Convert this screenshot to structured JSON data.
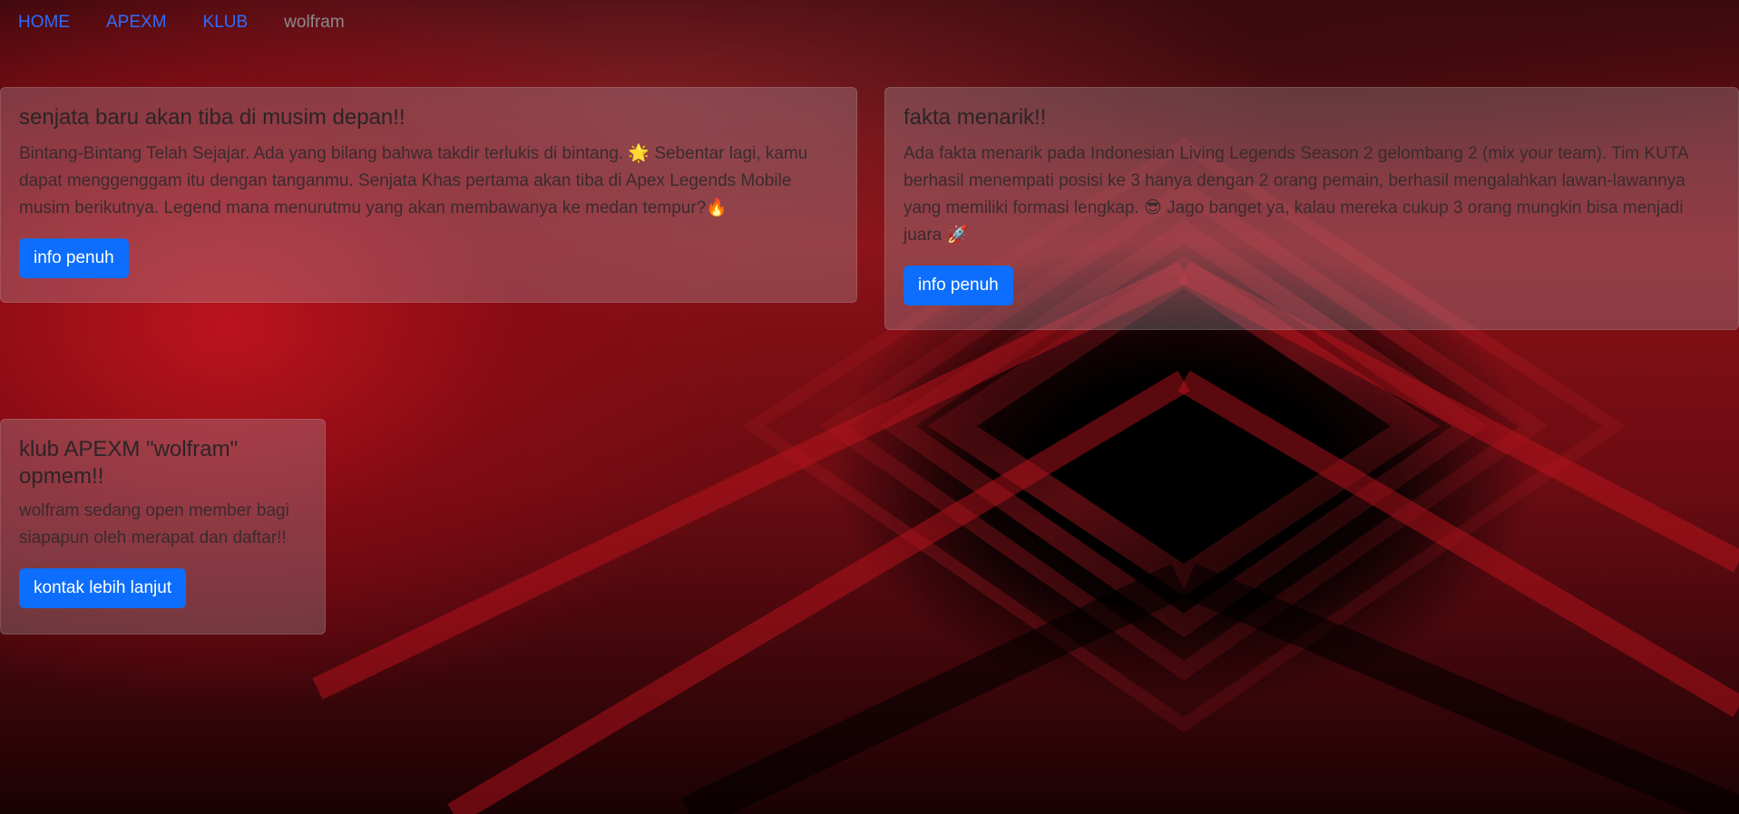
{
  "nav": {
    "items": [
      {
        "label": "HOME"
      },
      {
        "label": "APEXM"
      },
      {
        "label": "KLUB"
      }
    ],
    "brand": "wolfram"
  },
  "cards": [
    {
      "title": "senjata baru akan tiba di musim depan!!",
      "text": "Bintang-Bintang Telah Sejajar. Ada yang bilang bahwa takdir terlukis di bintang. 🌟 Sebentar lagi, kamu dapat menggenggam itu dengan tanganmu. Senjata Khas pertama akan tiba di Apex Legends Mobile musim berikutnya. Legend mana menurutmu yang akan membawanya ke medan tempur?🔥",
      "button": "info penuh"
    },
    {
      "title": "fakta menarik!!",
      "text": "Ada fakta menarik pada Indonesian Living Legends Season 2 gelombang 2 (mix your team). Tim KUTA berhasil menempati posisi ke 3 hanya dengan 2 orang pemain, berhasil mengalahkan lawan-lawannya yang memiliki formasi lengkap. 😎 Jago banget ya, kalau mereka cukup 3 orang mungkin bisa menjadi juara 🚀",
      "button": "info penuh"
    },
    {
      "title": "klub APEXM \"wolfram\" opmem!!",
      "text": "wolfram sedang open member bagi siapapun oleh merapat dan daftar!!",
      "button": "kontak lebih lanjut"
    }
  ],
  "colors": {
    "link": "#2f6bff",
    "button": "#0d6efd",
    "background_accent": "#b3101a"
  }
}
